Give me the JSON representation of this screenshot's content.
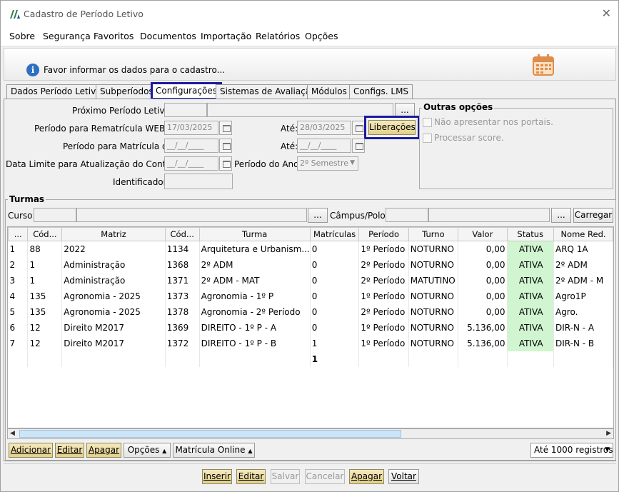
{
  "window": {
    "title": "Cadastro de Período Letivo"
  },
  "menu": [
    "Sobre",
    "Segurança",
    "Favoritos",
    "Documentos",
    "Importação",
    "Relatórios",
    "Opções"
  ],
  "banner": {
    "message": "Favor informar os dados para o cadastro..."
  },
  "tabs": [
    "Dados Período Letivo",
    "Subperíodos",
    "Configurações",
    "Sistemas de Avaliação",
    "Módulos",
    "Configs. LMS"
  ],
  "form": {
    "proximo_label": "Próximo Período Letivo:",
    "rematricula_label": "Período para Rematrícula WEB de:",
    "rematricula_de": "17/03/2025",
    "ate_label": "Até:",
    "rematricula_ate": "28/03/2025",
    "liberacoes": "Liberações",
    "matricula_label": "Período para Matrícula de:",
    "matricula_de": "__/__/____",
    "matricula_ate": "__/__/____",
    "data_limite_label": "Data Limite para Atualização do Contrato:",
    "data_limite": "__/__/____",
    "periodo_ano_label": "Período do Ano:",
    "periodo_ano": "2º Semestre",
    "identificador_label": "Identificador:"
  },
  "outras": {
    "title": "Outras opções",
    "opt1": "Não apresentar nos portais.",
    "opt2": "Processar score."
  },
  "turmas": {
    "title": "Turmas",
    "curso_label": "Curso:",
    "campus_label": "Câmpus/Polo:",
    "carregar": "Carregar",
    "dots": "...",
    "columns": [
      "...",
      "Cód...",
      "Matriz",
      "Cód...",
      "Turma",
      "Matrículas",
      "Período",
      "Turno",
      "Valor",
      "Status",
      "Nome Red."
    ],
    "rows": [
      [
        "1",
        "88",
        "2022",
        "1134",
        "Arquitetura e Urbanism...",
        "0",
        "1º Período",
        "NOTURNO",
        "0,00",
        "ATIVA",
        "ARQ 1A"
      ],
      [
        "2",
        "1",
        "Administração",
        "1368",
        "2º ADM",
        "0",
        "2º Período",
        "NOTURNO",
        "0,00",
        "ATIVA",
        "2º ADM"
      ],
      [
        "3",
        "1",
        "Administração",
        "1371",
        "2º ADM - MAT",
        "0",
        "2º Período",
        "MATUTINO",
        "0,00",
        "ATIVA",
        "2º ADM - M"
      ],
      [
        "4",
        "135",
        "Agronomia - 2025",
        "1373",
        "Agronomia - 1º P",
        "0",
        "1º Período",
        "NOTURNO",
        "0,00",
        "ATIVA",
        "Agro1P"
      ],
      [
        "5",
        "135",
        "Agronomia - 2025",
        "1378",
        "Agronomia - 2º Período",
        "0",
        "2º Período",
        "NOTURNO",
        "0,00",
        "ATIVA",
        "Agro."
      ],
      [
        "6",
        "12",
        "Direito M2017",
        "1369",
        "DIREITO - 1º P - A",
        "0",
        "1º Período",
        "NOTURNO",
        "5.136,00",
        "ATIVA",
        "DIR-N - A"
      ],
      [
        "7",
        "12",
        "Direito M2017",
        "1372",
        "DIREITO - 1º P - B",
        "1",
        "1º Período",
        "NOTURNO",
        "5.136,00",
        "ATIVA",
        "DIR-N - B"
      ]
    ],
    "total_matriculas": "1"
  },
  "grid_buttons": {
    "adicionar": "Adicionar",
    "editar": "Editar",
    "apagar": "Apagar",
    "opcoes": "Opções",
    "matricula_online": "Matrícula Online",
    "limit": "Até 1000 registros"
  },
  "footer": {
    "inserir": "Inserir",
    "editar": "Editar",
    "salvar": "Salvar",
    "cancelar": "Cancelar",
    "apagar": "Apagar",
    "voltar": "Voltar"
  }
}
